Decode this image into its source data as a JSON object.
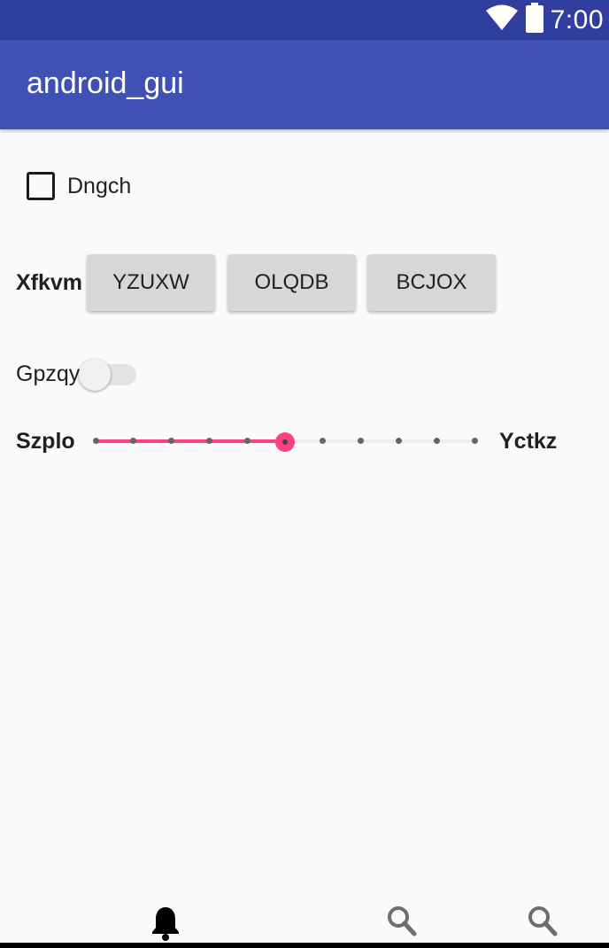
{
  "status_bar": {
    "time": "7:00",
    "icons": [
      "wifi-icon",
      "battery-icon"
    ]
  },
  "app_bar": {
    "title": "android_gui"
  },
  "checkbox": {
    "label": "Dngch",
    "checked": false
  },
  "button_row": {
    "label": "Xfkvm",
    "buttons": [
      "YZUXW",
      "OLQDB",
      "BCJOX"
    ]
  },
  "switch": {
    "label": "Gpzqy",
    "on": false
  },
  "slider": {
    "left_label": "Szplo",
    "right_label": "Yctkz",
    "steps": 10,
    "value": 5,
    "accent_color": "#ff4081"
  },
  "bottom_nav": {
    "icons": [
      "bell-icon",
      "search-icon",
      "search-icon"
    ]
  },
  "colors": {
    "status_bar": "#303f9f",
    "app_bar": "#3f51b5",
    "accent": "#ff4081",
    "button": "#d6d7d7"
  }
}
